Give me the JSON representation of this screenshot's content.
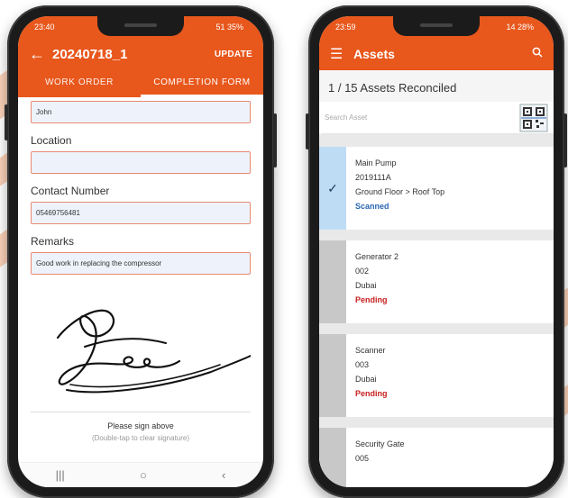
{
  "colors": {
    "brand": "#e8571c",
    "scanned": "#2a67b4",
    "pending": "#c81e1e"
  },
  "left_phone": {
    "status": {
      "time": "23:40",
      "battery": "51 35%"
    },
    "header": {
      "back_icon": "arrow-left-icon",
      "title": "20240718_1",
      "action": "UPDATE"
    },
    "tabs": [
      {
        "label": "WORK ORDER"
      },
      {
        "label": "COMPLETION FORM"
      }
    ],
    "form": {
      "name_value": "John",
      "location_label": "Location",
      "location_value": "",
      "contact_label": "Contact Number",
      "contact_value": "05469756481",
      "remarks_label": "Remarks",
      "remarks_value": "Good work in replacing the compressor"
    },
    "signature": {
      "caption": "Please sign above",
      "hint": "(Double-tap to clear signature)"
    }
  },
  "right_phone": {
    "status": {
      "time": "23:59",
      "battery": "14 28%"
    },
    "header": {
      "menu_icon": "hamburger-icon",
      "title": "Assets",
      "search_icon": "search-icon"
    },
    "reconciled": "1 / 15 Assets Reconciled",
    "search_placeholder": "Search Asset",
    "assets": [
      {
        "name": "Main Pump",
        "code": "2019111A",
        "location": "Ground Floor > Roof Top",
        "status": "Scanned"
      },
      {
        "name": "Generator 2",
        "code": "002",
        "location": "Dubai",
        "status": "Pending"
      },
      {
        "name": "Scanner",
        "code": "003",
        "location": "Dubai",
        "status": "Pending"
      },
      {
        "name": "Security Gate",
        "code": "005",
        "location": "",
        "status": ""
      }
    ]
  }
}
